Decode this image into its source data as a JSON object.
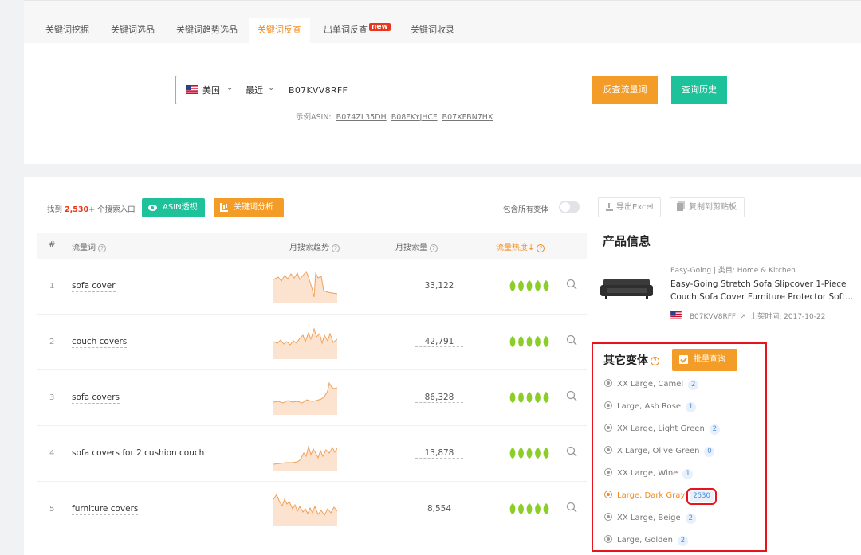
{
  "tabs": [
    {
      "label": "关键词挖掘",
      "active": false
    },
    {
      "label": "关键词选品",
      "active": false
    },
    {
      "label": "关键词趋势选品",
      "active": false
    },
    {
      "label": "关键词反查",
      "active": true
    },
    {
      "label": "出单词反查",
      "active": false,
      "badge": "new"
    },
    {
      "label": "关键词收录",
      "active": false
    }
  ],
  "search": {
    "country": "美国",
    "period": "最近",
    "value": "B07KVV8RFF",
    "submit_label": "反查流量词",
    "history_label": "查询历史",
    "examples_label": "示例ASIN:",
    "examples": [
      "B074ZL35DH",
      "B08FKYJHCF",
      "B07XFBN7HX"
    ]
  },
  "results": {
    "found_prefix": "找到",
    "found_count": "2,530+",
    "found_suffix": "个搜索入口",
    "asin_btn": "ASIN透视",
    "kw_btn": "关键词分析",
    "include_variants": "包含所有变体",
    "include_variants_on": false,
    "export_btn": "导出Excel",
    "copy_btn": "复制到剪贴板"
  },
  "table": {
    "headers": {
      "num": "#",
      "keyword": "流量词",
      "trend": "月搜索趋势",
      "volume": "月搜索量",
      "heat": "流量热度↓"
    },
    "rows": [
      {
        "num": "1",
        "keyword": "sofa cover",
        "volume": "33,122",
        "heat": 5
      },
      {
        "num": "2",
        "keyword": "couch covers",
        "volume": "42,791",
        "heat": 5
      },
      {
        "num": "3",
        "keyword": "sofa covers",
        "volume": "86,328",
        "heat": 5
      },
      {
        "num": "4",
        "keyword": "sofa covers for 2 cushion couch",
        "volume": "13,878",
        "heat": 5
      },
      {
        "num": "5",
        "keyword": "furniture covers",
        "volume": "8,554",
        "heat": 5
      }
    ]
  },
  "product": {
    "title": "产品信息",
    "brand": "Easy-Going",
    "category_label": "类目:",
    "category": "Home & Kitchen",
    "name": "Easy-Going Stretch Sofa Slipcover 1-Piece Couch Sofa Cover Furniture Protector Soft...",
    "asin": "B07KVV8RFF",
    "listed_label": "上架时间:",
    "listed": "2017-10-22"
  },
  "variants": {
    "title": "其它变体",
    "batch_btn": "批量查询",
    "items": [
      {
        "label": "XX Large, Camel",
        "count": "2",
        "active": false
      },
      {
        "label": "Large, Ash Rose",
        "count": "1",
        "active": false
      },
      {
        "label": "XX Large, Light Green",
        "count": "2",
        "active": false
      },
      {
        "label": "X Large, Olive Green",
        "count": "0",
        "active": false
      },
      {
        "label": "XX Large, Wine",
        "count": "1",
        "active": false
      },
      {
        "label": "Large, Dark Gray",
        "count": "2530",
        "active": true
      },
      {
        "label": "XX Large, Beige",
        "count": "2",
        "active": false
      },
      {
        "label": "Large, Golden",
        "count": "2",
        "active": false
      }
    ]
  },
  "colors": {
    "accent": "#f39c27",
    "green": "#1ec29a",
    "highlight_red": "#e8131c",
    "heat_leaf": "#8ccd2a"
  },
  "icons": {
    "eye": "eye-icon",
    "chart": "chart-icon",
    "search": "search-icon",
    "download": "download-icon",
    "copy": "copy-icon",
    "external": "external-link-icon",
    "leaf": "leaf-icon"
  }
}
